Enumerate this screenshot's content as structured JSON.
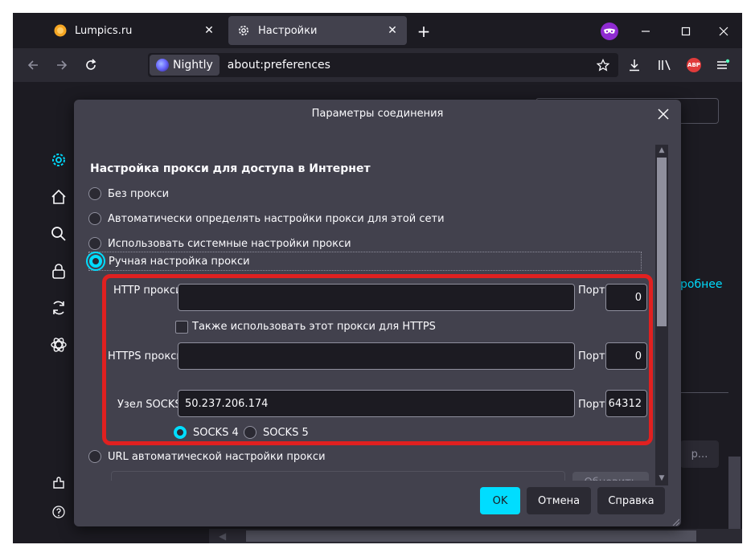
{
  "tabs": [
    {
      "title": "Lumpics.ru",
      "icon": "lumpics-favicon-icon"
    },
    {
      "title": "Настройки",
      "icon": "gear-icon"
    }
  ],
  "urlbar": {
    "identity": "Nightly",
    "url": "about:preferences"
  },
  "toolbar": {
    "abp_label": "ABP"
  },
  "background": {
    "link_fragment": "робнее",
    "button_fragment": "р..."
  },
  "dialog": {
    "title": "Параметры соединения",
    "section_title": "Настройка прокси для доступа в Интернет",
    "options": {
      "no_proxy": "Без прокси",
      "auto_detect": "Автоматически определять настройки прокси для этой сети",
      "system": "Использовать системные настройки прокси",
      "manual": "Ручная настройка прокси",
      "auto_url": "URL автоматической настройки прокси"
    },
    "selected_option": "manual",
    "http": {
      "label": "HTTP прокси",
      "value": "",
      "port_label": "Порт",
      "port": "0"
    },
    "also_https": {
      "label": "Также использовать этот прокси для HTTPS",
      "checked": false
    },
    "https": {
      "label": "HTTPS прокси",
      "value": "",
      "port_label": "Порт",
      "port": "0"
    },
    "socks": {
      "label": "Узел SOCKS",
      "value": "50.237.206.174",
      "port_label": "Порт",
      "port": "64312"
    },
    "socks_versions": {
      "v4": "SOCKS 4",
      "v5": "SOCKS 5",
      "selected": "v4"
    },
    "update_button": "Обновить",
    "buttons": {
      "ok": "OK",
      "cancel": "Отмена",
      "help": "Справка"
    }
  },
  "colors": {
    "accent": "#00ddff",
    "highlight": "#e02020",
    "dialog_bg": "#42414d",
    "window_bg": "#1c1b22"
  }
}
